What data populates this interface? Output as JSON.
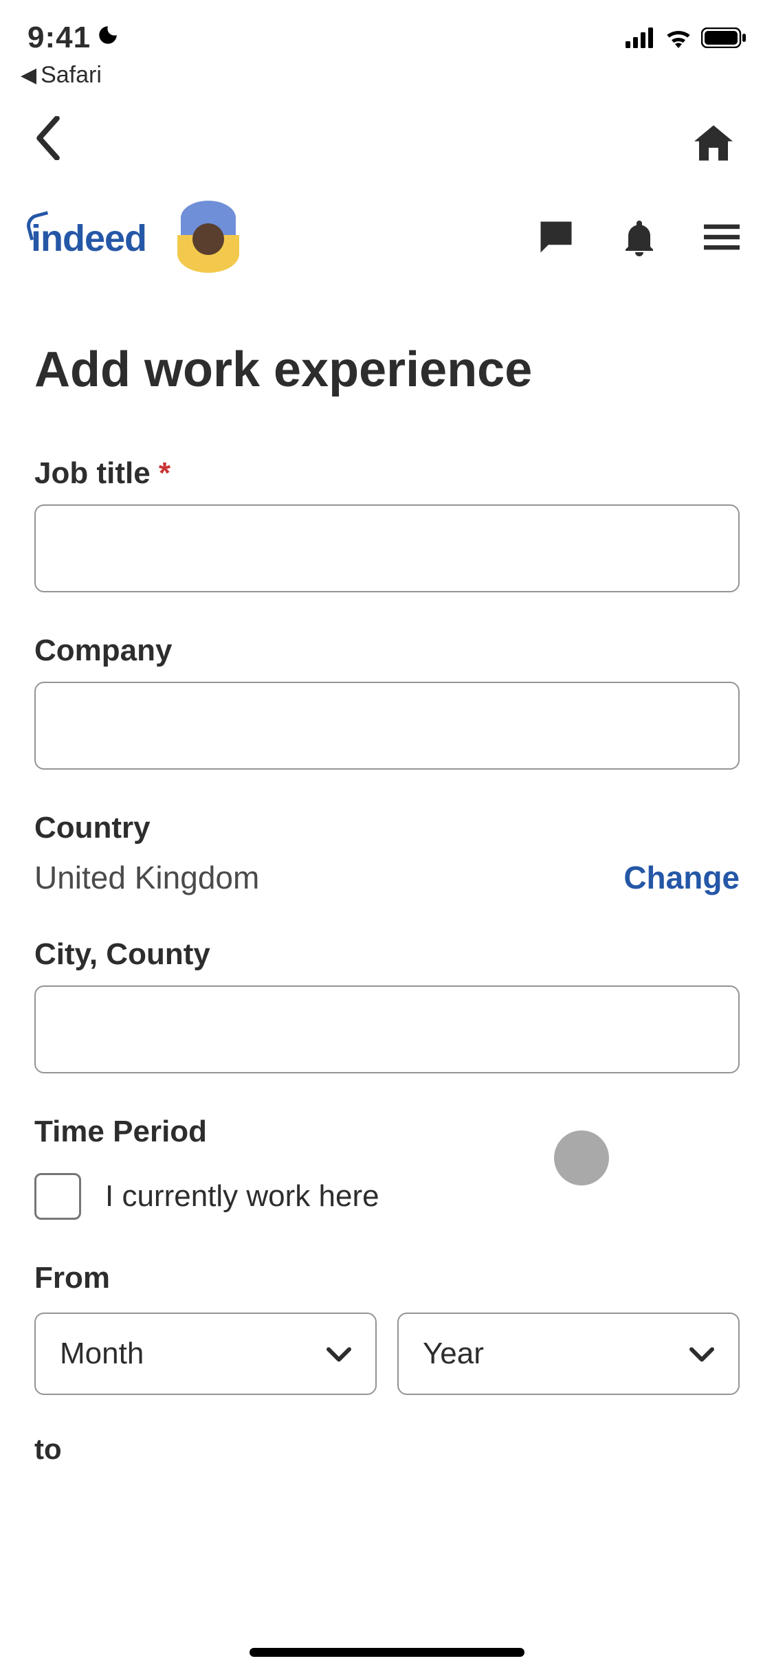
{
  "status": {
    "time": "9:41",
    "back_app": "Safari"
  },
  "header": {
    "brand": "indeed"
  },
  "page": {
    "title": "Add work experience"
  },
  "form": {
    "job_title": {
      "label": "Job title",
      "required": "*",
      "value": ""
    },
    "company": {
      "label": "Company",
      "value": ""
    },
    "country": {
      "label": "Country",
      "value": "United Kingdom",
      "change": "Change"
    },
    "city": {
      "label": "City, County",
      "value": ""
    },
    "time_period": {
      "label": "Time Period",
      "checkbox_label": "I currently work here"
    },
    "from": {
      "label": "From",
      "month": "Month",
      "year": "Year"
    },
    "to": {
      "label": "to"
    }
  }
}
